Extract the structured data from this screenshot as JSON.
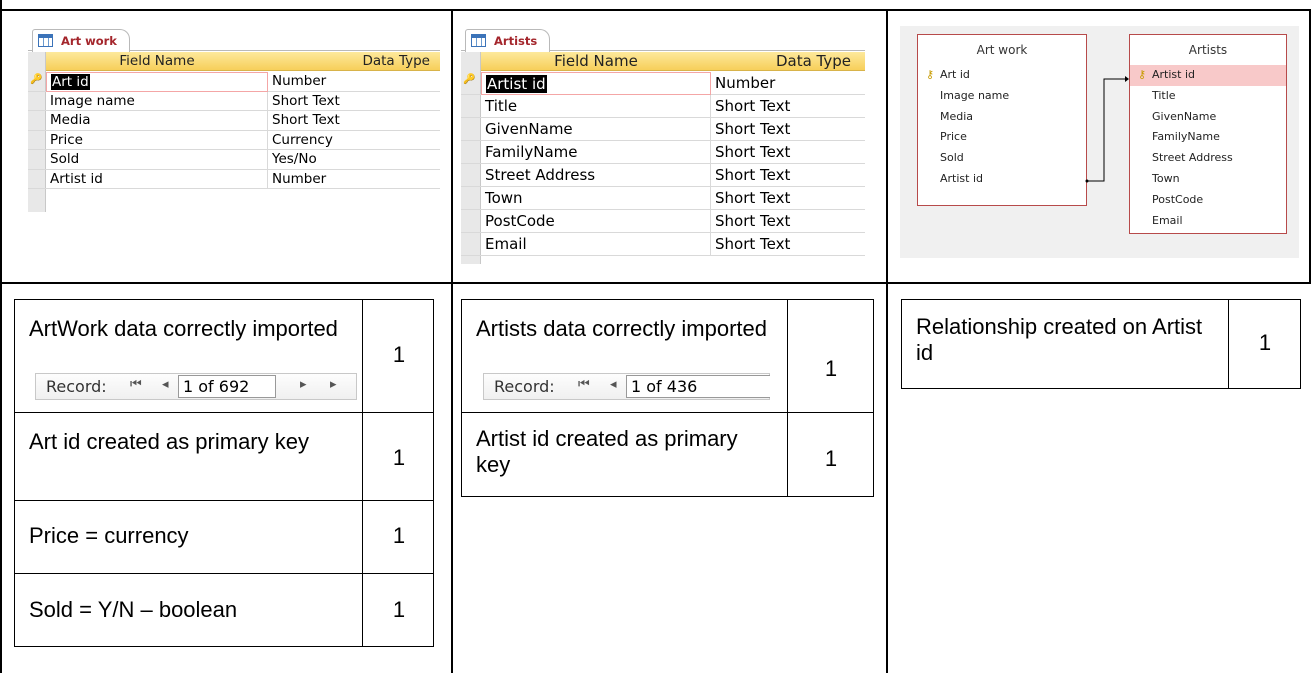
{
  "art_work_design": {
    "tab_title": "Art work",
    "headers": {
      "field": "Field Name",
      "type": "Data Type"
    },
    "rows": [
      {
        "field": "Art id",
        "type": "Number"
      },
      {
        "field": "Image name",
        "type": "Short Text"
      },
      {
        "field": "Media",
        "type": "Short Text"
      },
      {
        "field": "Price",
        "type": "Currency"
      },
      {
        "field": "Sold",
        "type": "Yes/No"
      },
      {
        "field": "Artist id",
        "type": "Number"
      }
    ]
  },
  "artists_design": {
    "tab_title": "Artists",
    "headers": {
      "field": "Field Name",
      "type": "Data Type"
    },
    "rows": [
      {
        "field": "Artist id",
        "type": "Number"
      },
      {
        "field": "Title",
        "type": "Short Text"
      },
      {
        "field": "GivenName",
        "type": "Short Text"
      },
      {
        "field": "FamilyName",
        "type": "Short Text"
      },
      {
        "field": "Street Address",
        "type": "Short Text"
      },
      {
        "field": "Town",
        "type": "Short Text"
      },
      {
        "field": "PostCode",
        "type": "Short Text"
      },
      {
        "field": "Email",
        "type": "Short Text"
      }
    ]
  },
  "relationships": {
    "left_table": {
      "title": "Art work",
      "fields": [
        "Art id",
        "Image name",
        "Media",
        "Price",
        "Sold",
        "Artist id"
      ]
    },
    "right_table": {
      "title": "Artists",
      "fields": [
        "Artist id",
        "Title",
        "GivenName",
        "FamilyName",
        "Street Address",
        "Town",
        "PostCode",
        "Email"
      ]
    }
  },
  "marks": {
    "col1": [
      {
        "text": "ArtWork data correctly imported",
        "mark": "1",
        "record_label": "Record:",
        "record_value": "1 of 692"
      },
      {
        "text": "Art id created as primary key",
        "mark": "1"
      },
      {
        "text": "Price = currency",
        "mark": "1"
      },
      {
        "text": "Sold = Y/N – boolean",
        "mark": "1"
      }
    ],
    "col2": [
      {
        "text": "Artists data correctly imported",
        "mark": "1",
        "record_label": "Record:",
        "record_value": "1 of 436"
      },
      {
        "text": "Artist id created as primary key",
        "mark": "1"
      }
    ],
    "col3": [
      {
        "text": "Relationship created on Artist id",
        "mark": "1"
      }
    ]
  },
  "colors": {
    "key_yellow": "#c79b00",
    "header_gold": "#f7cf5a",
    "rel_border": "#b74a4a",
    "rel_highlight": "#f8c9c9"
  }
}
